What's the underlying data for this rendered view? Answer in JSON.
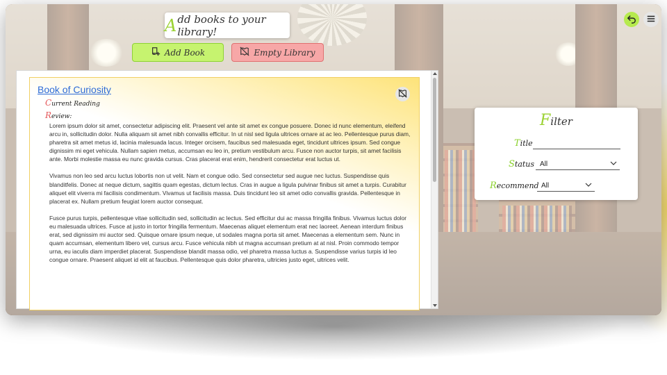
{
  "header": {
    "title_cap": "A",
    "title_rest": "dd books to your library!"
  },
  "toolbar": {
    "add_label": "Add Book",
    "empty_label": "Empty Library"
  },
  "book": {
    "title": "Book of Curiosity",
    "status_cap": "C",
    "status_rest": "urrent Reading",
    "review_cap": "R",
    "review_rest": "eview:",
    "review_paragraphs": [
      "Lorem ipsum dolor sit amet, consectetur adipiscing elit. Praesent vel ante sit amet ex congue posuere. Donec id nunc elementum, eleifend arcu in, sollicitudin dolor. Nulla aliquam sit amet nibh convallis efficitur. In ut nisl sed ligula ultrices ornare at ac leo. Pellentesque purus diam, pharetra sit amet metus id, lacinia malesuada lacus. Integer orcisem, faucibus sed malesuada eget, tincidunt ultrices ipsum. Sed congue dignissim mi eget vehicula. Nullam sapien metus, accumsan eu leo in, pretium vestibulum arcu. Fusce non auctor turpis, sit amet facilisis ante. Morbi molestie massa eu nunc gravida cursus. Cras placerat erat enim, hendrerit consectetur erat luctus ut.",
      "Vivamus non leo sed arcu luctus lobortis non ut velit. Nam et congue odio. Sed consectetur sed augue nec luctus. Suspendisse quis blanditfelis. Donec at neque dictum, sagittis quam egestas, dictum lectus. Cras in augue a ligula pulvinar finibus sit amet a turpis. Curabitur aliquet elit viverra mi facilisis condimentum. Vivamus ut facilisis massa. Duis tincidunt leo sit amet odio convallis gravida. Pellentesque in placerat ex. Nullam pretium feugiat lorem auctor consequat.",
      "Fusce purus turpis, pellentesque vitae sollicitudin sed, sollicitudin ac lectus. Sed efficitur dui ac massa fringilla finibus. Vivamus luctus dolor eu malesuada ultrices. Fusce at justo in tortor fringilla fermentum. Maecenas aliquet elementum erat nec laoreet. Aenean interdum finibus erat, sed dignissim mi auctor sed. Quisque ornare ipsum neque, ut sodales magna porta sit amet. Maecenas a elementum sem. Nunc in quam accumsan, elementum libero vel, cursus arcu. Fusce vehicula nibh ut magna accumsan pretium at at nisl. Proin commodo tempor urna, eu iaculis diam imperdiet placerat. Suspendisse blandit massa odio, vel pharetra massa luctus a. Suspendisse varius turpis id leo congue ornare. Praesent aliquet id elit at faucibus. Pellentesque quis dolor pharetra, ultricies justo eget, ultrices velit."
    ]
  },
  "filter": {
    "title_cap": "F",
    "title_rest": "ilter",
    "title_label_cap": "T",
    "title_label_rest": "itle",
    "title_value": "",
    "status_label_cap": "S",
    "status_label_rest": "tatus",
    "status_value": "All",
    "recommend_label_cap": "R",
    "recommend_label_rest": "ecommend",
    "recommend_value": "All"
  },
  "icons": {
    "add": "book-plus-icon",
    "empty": "book-off-icon",
    "back": "undo-arrow-icon",
    "menu": "hamburger-menu-icon",
    "remove": "book-off-icon",
    "dropdown": "chevron-down-icon"
  },
  "colors": {
    "accent_green": "#9bd232",
    "add_button": "#c6f36f",
    "empty_button": "#f7a7a7",
    "card_highlight": "#fde37a",
    "link_blue": "#2d6bd6",
    "red_initial": "#e4575a"
  }
}
